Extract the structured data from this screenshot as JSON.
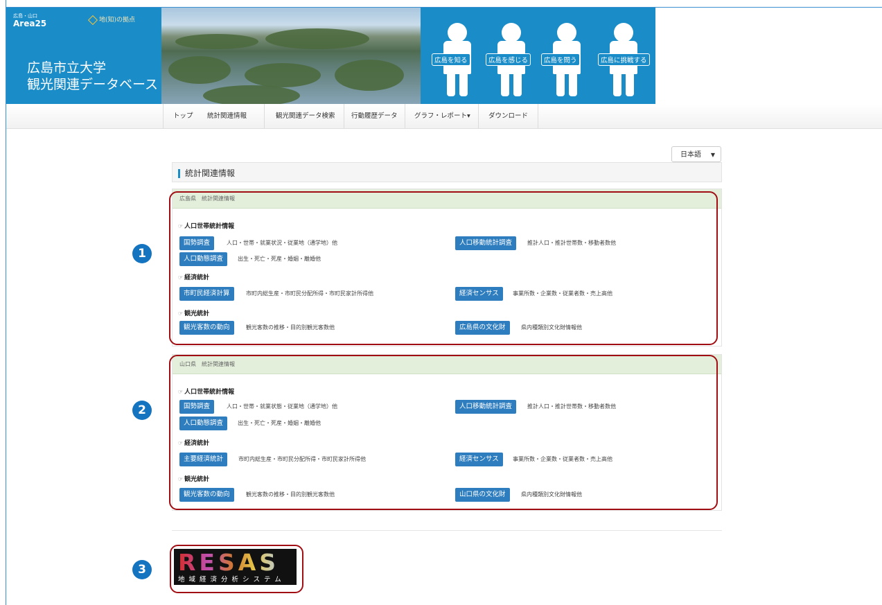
{
  "header": {
    "area_small": "広島・山口",
    "area_big": "Area25",
    "chinochi": "地(知)の拠点",
    "title_line1": "広島市立大学",
    "title_line2": "観光関連データベース",
    "figures": [
      "広島を知る",
      "広島を感じる",
      "広島を問う",
      "広島に挑戦する"
    ]
  },
  "nav": {
    "items": [
      "トップ",
      "統計関連情報",
      "観光関連データ検索",
      "行動履歴データ",
      "グラフ・レポート",
      "ダウンロード"
    ],
    "caret": "▾"
  },
  "language": {
    "selected": "日本語",
    "arrow": "▼"
  },
  "page_title": "統計関連情報",
  "panels": [
    {
      "header": "広島県　統計関連情報",
      "sections": [
        {
          "icon": "☞",
          "title": "人口世帯統計情報",
          "rows": [
            {
              "left": {
                "button": "国勢調査",
                "desc": "人口・世帯・就業状況・従業地（通学地）他"
              },
              "right": {
                "button": "人口移動統計調査",
                "desc": "推計人口・推計世帯数・移動者数他"
              }
            },
            {
              "left": {
                "button": "人口動態調査",
                "desc": "出生・死亡・死産・婚姻・離婚他"
              }
            }
          ]
        },
        {
          "icon": "☞",
          "title": "経済統計",
          "rows": [
            {
              "left": {
                "button": "市町民経済計算",
                "desc": "市町内総生産・市町民分配所得・市町民家計所得他"
              },
              "right": {
                "button": "経済センサス",
                "desc": "事業所数・企業数・従業者数・売上高他"
              }
            }
          ]
        },
        {
          "icon": "☞",
          "title": "観光統計",
          "rows": [
            {
              "left": {
                "button": "観光客数の動向",
                "desc": "観光客数の推移・目的別観光客数他"
              },
              "right": {
                "button": "広島県の文化財",
                "desc": "県内種類別文化財情報他"
              }
            }
          ]
        }
      ]
    },
    {
      "header": "山口県　統計関連情報",
      "sections": [
        {
          "icon": "☞",
          "title": "人口世帯統計情報",
          "rows": [
            {
              "left": {
                "button": "国勢調査",
                "desc": "人口・世帯・就業状態・従業地（通学地）他"
              },
              "right": {
                "button": "人口移動統計調査",
                "desc": "推計人口・推計世帯数・移動者数他"
              }
            },
            {
              "left": {
                "button": "人口動態調査",
                "desc": "出生・死亡・死産・婚姻・離婚他"
              }
            }
          ]
        },
        {
          "icon": "☞",
          "title": "経済統計",
          "rows": [
            {
              "left": {
                "button": "主要経済統計",
                "desc": "市町内総生産・市町民分配所得・市町民家計所得他"
              },
              "right": {
                "button": "経済センサス",
                "desc": "事業所数・企業数・従業者数・売上高他"
              }
            }
          ]
        },
        {
          "icon": "☞",
          "title": "観光統計",
          "rows": [
            {
              "left": {
                "button": "観光客数の動向",
                "desc": "観光客数の推移・目的別観光客数他"
              },
              "right": {
                "button": "山口県の文化財",
                "desc": "県内種類別文化財情報他"
              }
            }
          ]
        }
      ]
    }
  ],
  "callouts": [
    "1",
    "2",
    "3"
  ],
  "resas": {
    "logo_text": "RESAS",
    "subtitle": "地域経済分析システム"
  },
  "colors": {
    "brand": "#1a8cc8",
    "button": "#2d7dbf",
    "highlight": "#a00d12",
    "callout": "#1474c0",
    "panel_header": "#e3efdb"
  }
}
